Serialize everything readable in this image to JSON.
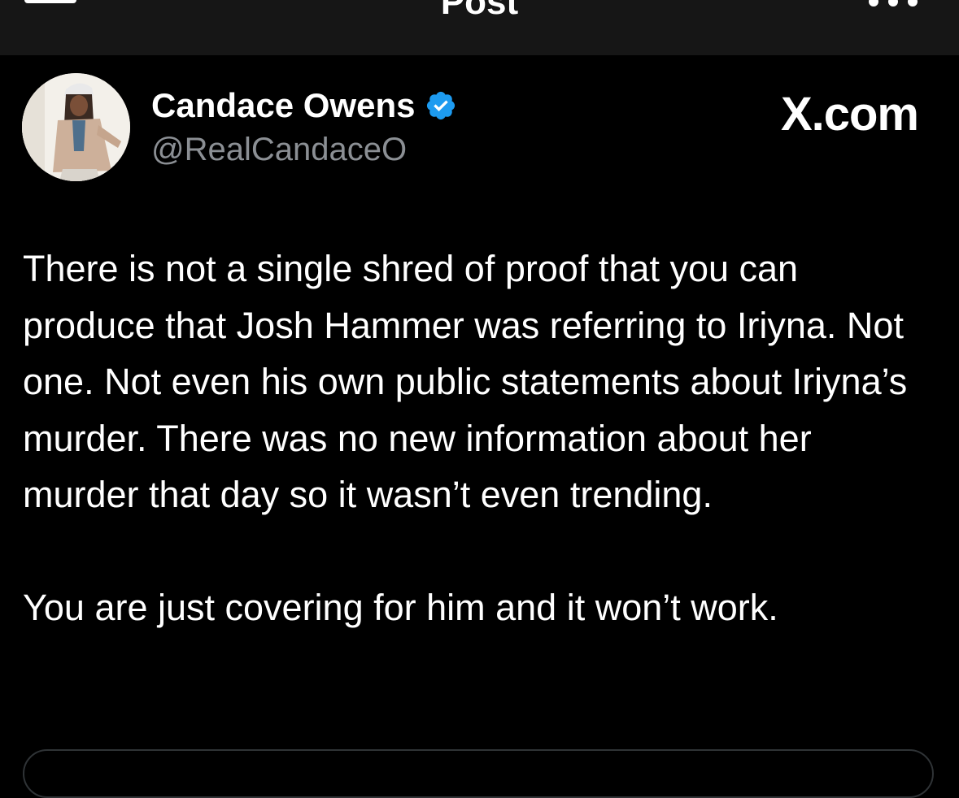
{
  "header": {
    "title": "Post",
    "back_icon": "arrow-left-icon",
    "more_icon": "more-horizontal-icon"
  },
  "author": {
    "name": "Candace Owens",
    "handle": "@RealCandaceO",
    "verified_icon": "verified-badge-icon",
    "verified_color": "#1d9bf0"
  },
  "site": {
    "label": "X.com"
  },
  "post": {
    "paragraphs": [
      "There is not a single shred of proof that you can produce that Josh Hammer was referring to Iriyna. Not one. Not even his own public statements about Iriyna’s murder. There was no new information about her murder that day so it wasn’t even trending.",
      "You are just covering for him and it won’t work."
    ]
  },
  "colors": {
    "background": "#000000",
    "header_background": "#161616",
    "text_primary": "#ffffff",
    "text_secondary": "#8b8f94",
    "accent": "#1d9bf0"
  }
}
